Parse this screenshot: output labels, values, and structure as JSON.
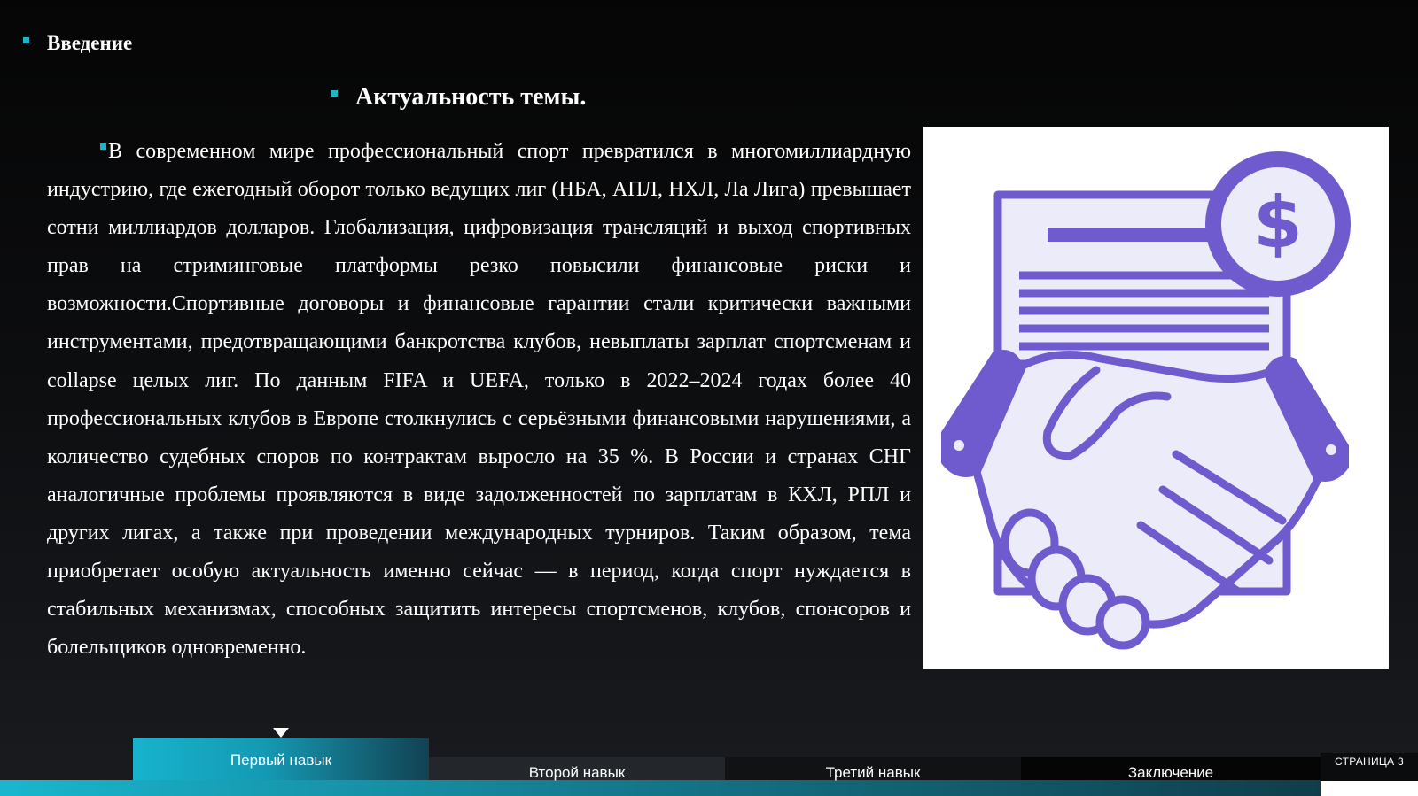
{
  "slide": {
    "section_label": "Введение",
    "topic_title": "Актуальность темы.",
    "body_text": "В современном мире профессиональный спорт превратился в многомиллиардную индустрию, где ежегодный оборот только ведущих лиг (НБА, АПЛ, НХЛ, Ла Лига) превышает сотни миллиардов долларов. Глобализация, цифровизация трансляций и выход спортивных прав на стриминговые платформы резко повысили финансовые риски и возможности.Спортивные договоры и финансовые гарантии стали критически важными инструментами, предотвращающими банкротства клубов, невыплаты зарплат спортсменам и collapse целых лиг. По данным FIFA и UEFA, только в 2022–2024 годах более 40 профессиональных клубов в Европе столкнулись с серьёзными финансовыми нарушениями, а количество судебных споров по контрактам выросло на 35 %. В России и странах СНГ аналогичные проблемы проявляются в виде задолженностей по зарплатам в КХЛ, РПЛ и других лигах, а также при проведении международных турниров. Таким образом, тема приобретает особую актуальность именно сейчас — в период, когда спорт нуждается в стабильных механизмах, способных защитить интересы спортсменов, клубов, спонсоров и болельщиков одновременно.",
    "illustration": {
      "icon": "handshake-contract-dollar-icon",
      "dollar_symbol": "$"
    }
  },
  "navigation": {
    "tabs": [
      {
        "label": "Первый навык",
        "active": true
      },
      {
        "label": "Второй навык",
        "active": false
      },
      {
        "label": "Третий навык",
        "active": false
      },
      {
        "label": "Заключение",
        "active": false
      }
    ],
    "page_label": "СТРАНИЦА 3"
  },
  "colors": {
    "accent": "#1fb4c8",
    "icon_stroke": "#6f5bcd",
    "icon_fill": "#ecebf9",
    "background": "#0c0d0f"
  }
}
